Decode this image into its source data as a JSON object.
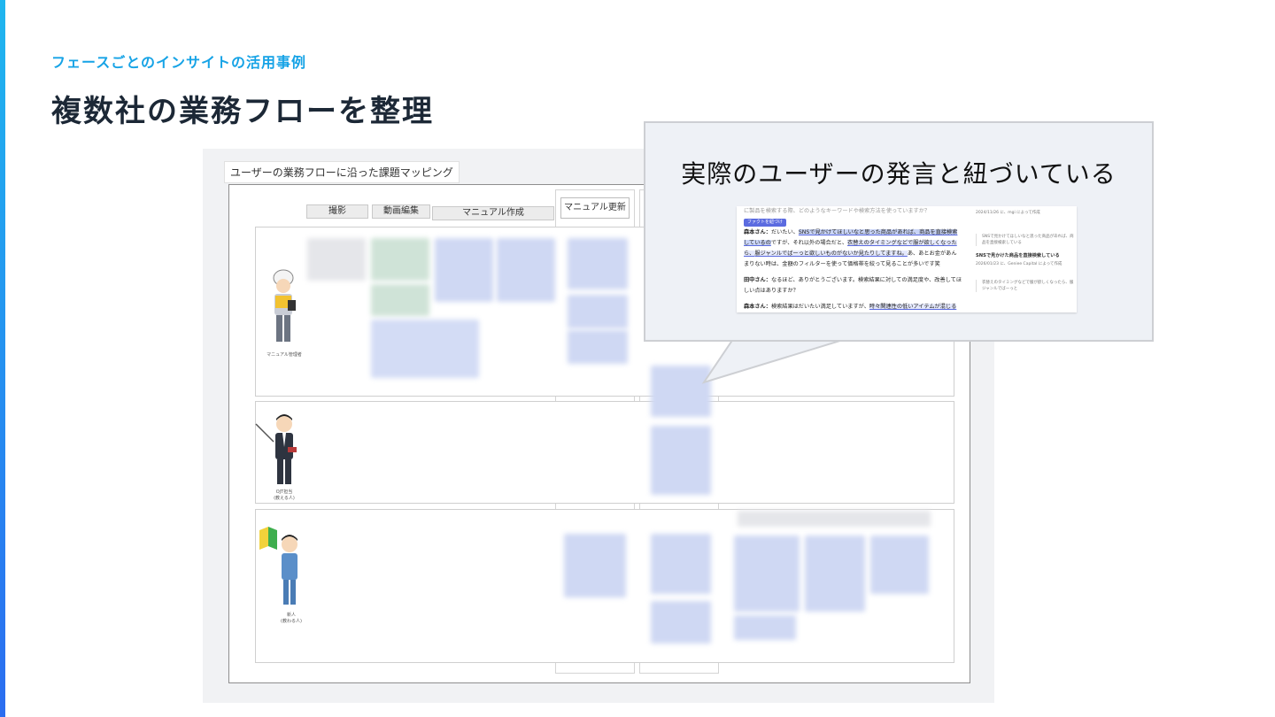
{
  "slide": {
    "eyebrow": "フェースごとのインサイトの活用事例",
    "title": "複数社の業務フローを整理",
    "accent_colors": [
      "#1fb6ef",
      "#2b6df0"
    ]
  },
  "board": {
    "label": "ユーザーの業務フローに沿った課題マッピング",
    "columns": [
      "撮影",
      "動画編集",
      "マニュアル作成",
      "マニュアル更新"
    ],
    "lanes": [
      {
        "label": "マニュアル管理者"
      },
      {
        "label": "OJT担当\n(教える人)"
      },
      {
        "label": "新人\n(教わる人)"
      }
    ]
  },
  "callout": {
    "title": "実際のユーザーの発言と紐づいている",
    "doc": {
      "top_line": "に製品を検索する際、どのようなキーワードや検索方法を使っていますか？",
      "chip": "ファクトを紐づけ",
      "speaker1": "森本さん：",
      "speaker1_pre": "だいたい、",
      "speaker1_hl1": "SNSで見かけてほしいなと思った商品があれば、商品を直接検索しているの",
      "speaker1_mid": "ですが、それ以外の場合だと、",
      "speaker1_hl2": "衣替えのタイミングなどで服が欲しくなったら、",
      "speaker1_hl3": "服ジャンルでばーっと欲しいものがないか見たりしてますね。",
      "speaker1_end": "あ、あとお金があんまりない時は、金額のフィルターを使って価格帯を絞って見ることが多いです笑",
      "speaker2": "田中さん：",
      "speaker2_text": "なるほど、ありがとうございます。検索結果に対しての満足度や、改善してほしい点はありますか？",
      "speaker3": "森本さん：",
      "speaker3_text": "検索結果はだいたい満足していますが、",
      "speaker3_hl": "時々関連性の低いアイテムが混じることがあります。",
      "side_meta1": "2024/11/26 に、mgi によって作成",
      "side_note1": "SNSで見かけてほしいなと思った商品があれば、商品を直接検索している",
      "side_title": "SNSで見かけた商品を直接検索している",
      "side_meta2": "2026/01/23 に、Geniee Capital によって作成",
      "side_note2": "衣替えのタイミングなどで服が欲しくなったら、服ジャンルでばーっと"
    }
  }
}
